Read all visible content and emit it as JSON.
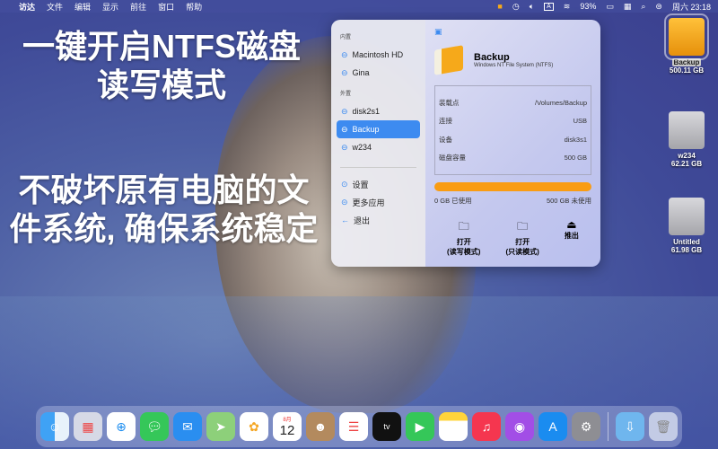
{
  "menubar": {
    "apple": "",
    "items": [
      "访达",
      "文件",
      "编辑",
      "显示",
      "前往",
      "窗口",
      "帮助"
    ],
    "battery": "93%",
    "clock": "周六 23:18"
  },
  "promo": {
    "line1": "一键开启NTFS磁盘读写模式",
    "line2": "不破坏原有电脑的文件系统, 确保系统稳定"
  },
  "sidebar": {
    "internal_label": "内置",
    "internal": [
      "Macintosh HD",
      "Gina"
    ],
    "external_label": "外置",
    "external": [
      "disk2s1",
      "Backup",
      "w234"
    ],
    "selected": "Backup",
    "actions": [
      "设置",
      "更多应用",
      "退出"
    ]
  },
  "detail": {
    "name": "Backup",
    "fs": "Windows NT File System (NTFS)",
    "rows": [
      {
        "k": "装载点",
        "v": "/Volumes/Backup"
      },
      {
        "k": "连接",
        "v": "USB"
      },
      {
        "k": "设备",
        "v": "disk3s1"
      },
      {
        "k": "磁盘容量",
        "v": "500 GB"
      }
    ],
    "used": "0 GB 已使用",
    "free": "500 GB 未使用",
    "usage_fraction_free": 1.0,
    "buttons": [
      {
        "l1": "打开",
        "l2": "(读写模式)"
      },
      {
        "l1": "打开",
        "l2": "(只读模式)"
      },
      {
        "l1": "推出",
        "l2": ""
      }
    ]
  },
  "desktop": [
    {
      "name": "Backup",
      "size": "500.11 GB"
    },
    {
      "name": "w234",
      "size": "62.21 GB"
    },
    {
      "name": "Untitled",
      "size": "61.98 GB"
    }
  ],
  "dock": {
    "calendar_month": "8月",
    "calendar_day": "12",
    "apps": [
      "finder",
      "launchpad",
      "safari",
      "messages",
      "mail",
      "maps",
      "photos",
      "calendar",
      "contacts",
      "reminders",
      "tv",
      "facetime",
      "notes",
      "music",
      "podcasts",
      "app-store",
      "system-preferences",
      "downloads",
      "trash"
    ]
  },
  "colors": {
    "accent": "#3d8bf0",
    "bar": "#f99c13"
  }
}
